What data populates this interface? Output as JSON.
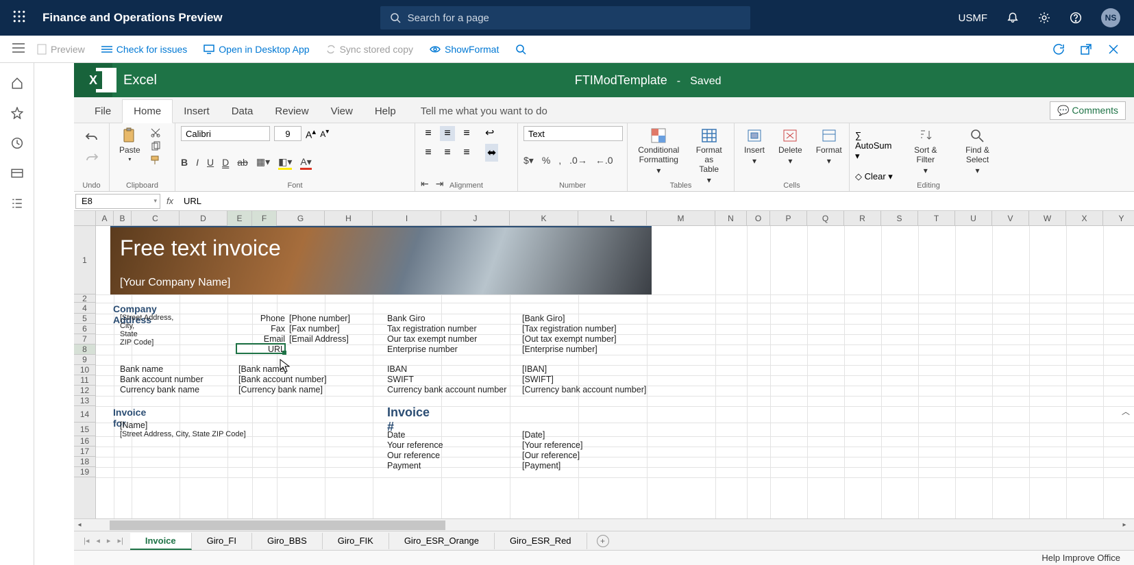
{
  "topnav": {
    "app_title": "Finance and Operations Preview",
    "search_placeholder": "Search for a page",
    "company": "USMF",
    "avatar": "NS"
  },
  "cmdbar": {
    "preview": "Preview",
    "check": "Check for issues",
    "open_desktop": "Open in Desktop App",
    "sync": "Sync stored copy",
    "show_format": "ShowFormat"
  },
  "excel": {
    "app_word": "Excel",
    "doc_name": "FTIModTemplate",
    "saved_state": "Saved",
    "tabs": {
      "file": "File",
      "home": "Home",
      "insert": "Insert",
      "data": "Data",
      "review": "Review",
      "view": "View",
      "help": "Help"
    },
    "tell_me": "Tell me what you want to do",
    "comments": "Comments",
    "ribbon": {
      "undo": "Undo",
      "paste": "Paste",
      "clipboard": "Clipboard",
      "font_name": "Calibri",
      "font_size": "9",
      "font": "Font",
      "alignment": "Alignment",
      "number_format": "Text",
      "number": "Number",
      "cond_fmt": "Conditional Formatting",
      "fmt_table": "Format as Table",
      "tables": "Tables",
      "insert": "Insert",
      "delete": "Delete",
      "format": "Format",
      "cells": "Cells",
      "autosum": "AutoSum",
      "clear": "Clear",
      "sort_filter": "Sort & Filter",
      "find_select": "Find & Select",
      "editing": "Editing"
    },
    "formula_bar": {
      "cell_ref": "E8",
      "formula": "URL"
    },
    "columns": [
      "A",
      "B",
      "C",
      "D",
      "E",
      "F",
      "G",
      "H",
      "I",
      "J",
      "K",
      "L",
      "M",
      "N",
      "O",
      "P",
      "Q",
      "R",
      "S",
      "T",
      "U",
      "V",
      "W",
      "X",
      "Y"
    ],
    "rows": [
      "1",
      "2",
      "4",
      "5",
      "6",
      "7",
      "8",
      "9",
      "10",
      "11",
      "12",
      "13",
      "14",
      "15",
      "16",
      "17",
      "18",
      "19"
    ],
    "content": {
      "title": "Free text invoice",
      "subtitle": "[Your Company Name]",
      "sec_company": "Company Address",
      "addr1": "[Street Address,",
      "addr2": "City,",
      "addr3": "State",
      "addr4": "ZIP Code]",
      "phone_lbl": "Phone",
      "phone_val": "[Phone number]",
      "fax_lbl": "Fax",
      "fax_val": "[Fax number]",
      "email_lbl": "Email",
      "email_val": "[Email Address]",
      "url_lbl": "URL",
      "bankgiro_lbl": "Bank Giro",
      "bankgiro_val": "[Bank Giro]",
      "taxreg_lbl": "Tax registration number",
      "taxreg_val": "[Tax registration number]",
      "taxex_lbl": "Our tax exempt number",
      "taxex_val": "[Out tax exempt number]",
      "ent_lbl": "Enterprise number",
      "ent_val": "[Enterprise number]",
      "bankname_lbl": "Bank name",
      "bankname_val": "[Bank name]",
      "bankacc_lbl": "Bank account number",
      "bankacc_val": "[Bank account number]",
      "curbank_lbl": "Currency bank name",
      "curbank_val": "[Currency bank name]",
      "iban_lbl": "IBAN",
      "iban_val": "[IBAN]",
      "swift_lbl": "SWIFT",
      "swift_val": "[SWIFT]",
      "curacc_lbl": "Currency bank account number",
      "curacc_val": "[Currency bank account number]",
      "sec_invoice_for": "Invoice for",
      "invfor_name": "[Name]",
      "invfor_addr": "[Street Address, City, State ZIP Code]",
      "sec_invoice_num": "Invoice #",
      "date_lbl": "Date",
      "date_val": "[Date]",
      "yref_lbl": "Your reference",
      "yref_val": "[Your reference]",
      "oref_lbl": "Our reference",
      "oref_val": "[Our reference]",
      "pay_lbl": "Payment",
      "pay_val": "[Payment]"
    },
    "sheet_tabs": [
      "Invoice",
      "Giro_FI",
      "Giro_BBS",
      "Giro_FIK",
      "Giro_ESR_Orange",
      "Giro_ESR_Red"
    ],
    "status": "Help Improve Office"
  }
}
